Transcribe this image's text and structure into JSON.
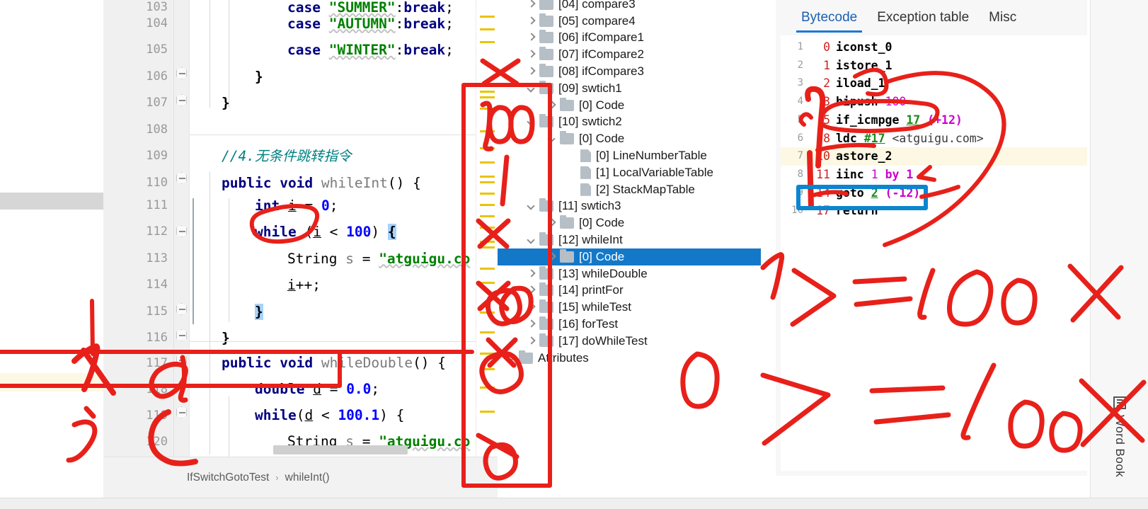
{
  "editor": {
    "breadcrumb": {
      "class_name": "IfSwitchGotoTest",
      "separator": "›",
      "method_name": "whileInt()"
    },
    "lines": [
      {
        "num": "103",
        "indent": 0
      },
      {
        "num": "104",
        "indent": 0
      },
      {
        "num": "105",
        "indent": 0
      },
      {
        "num": "106",
        "indent": 0
      },
      {
        "num": "107",
        "indent": 0
      },
      {
        "num": "108",
        "indent": 0
      },
      {
        "num": "109",
        "indent": 0
      },
      {
        "num": "110",
        "indent": 0
      },
      {
        "num": "111",
        "indent": 0
      },
      {
        "num": "112",
        "indent": 0
      },
      {
        "num": "113",
        "indent": 0
      },
      {
        "num": "114",
        "indent": 0
      },
      {
        "num": "115",
        "indent": 0
      },
      {
        "num": "116",
        "indent": 0
      },
      {
        "num": "117",
        "indent": 0
      },
      {
        "num": "118",
        "indent": 0
      },
      {
        "num": "119",
        "indent": 0
      },
      {
        "num": "120",
        "indent": 0
      }
    ],
    "code": {
      "l103": "case \"SUMMER\":break;",
      "l104": "case \"AUTUMN\":break;",
      "l105": "case \"WINTER\":break;",
      "l106": "}",
      "l107": "}",
      "l108": "",
      "l109": "//4.无条件跳转指令",
      "l110": "public void whileInt() {",
      "l111": "int i = 0;",
      "l112": "while (i < 100) {",
      "l113": "String s = \"atguigu.co",
      "l114": "i++;",
      "l115": "}",
      "l116": "}",
      "l117": "public void whileDouble() {",
      "l118": "double d = 0.0;",
      "l119": "while(d < 100.1) {",
      "l120": "String s = \"atguigu.co"
    },
    "tokens": {
      "kw_case": "case",
      "kw_break": "break",
      "kw_public": "public",
      "kw_void": "void",
      "kw_int": "int",
      "kw_double": "double",
      "kw_while": "while",
      "kw_String": "String",
      "str_summer": "\"SUMMER\"",
      "str_autumn": "\"AUTUMN\"",
      "str_winter": "\"WINTER\"",
      "str_atguigu": "\"atguigu.co",
      "num_0": "0",
      "num_100": "100",
      "num_0_0": "0.0",
      "num_100_1": "100.1",
      "m_whileInt": "whileInt",
      "m_whileDouble": "whileDouble",
      "v_i": "i",
      "v_d": "d",
      "v_s": "s",
      "comment109": "//4.无条件跳转指令"
    }
  },
  "tree": {
    "items": [
      {
        "label": "[04] compare3",
        "depth": 1,
        "twist": "right",
        "icon": "folder",
        "state": "normal"
      },
      {
        "label": "[05] compare4",
        "depth": 1,
        "twist": "right",
        "icon": "folder",
        "state": "normal"
      },
      {
        "label": "[06] ifCompare1",
        "depth": 1,
        "twist": "right",
        "icon": "folder",
        "state": "normal"
      },
      {
        "label": "[07] ifCompare2",
        "depth": 1,
        "twist": "right",
        "icon": "folder",
        "state": "normal"
      },
      {
        "label": "[08] ifCompare3",
        "depth": 1,
        "twist": "right",
        "icon": "folder",
        "state": "normal"
      },
      {
        "label": "[09] swtich1",
        "depth": 1,
        "twist": "down",
        "icon": "folder",
        "state": "normal"
      },
      {
        "label": "[0] Code",
        "depth": 2,
        "twist": "right",
        "icon": "folder",
        "state": "normal"
      },
      {
        "label": "[10] swtich2",
        "depth": 1,
        "twist": "down",
        "icon": "folder",
        "state": "normal"
      },
      {
        "label": "[0] Code",
        "depth": 2,
        "twist": "down",
        "icon": "folder",
        "state": "normal"
      },
      {
        "label": "[0] LineNumberTable",
        "depth": 3,
        "twist": "none",
        "icon": "attr",
        "state": "normal"
      },
      {
        "label": "[1] LocalVariableTable",
        "depth": 3,
        "twist": "none",
        "icon": "attr",
        "state": "normal"
      },
      {
        "label": "[2] StackMapTable",
        "depth": 3,
        "twist": "none",
        "icon": "attr",
        "state": "normal"
      },
      {
        "label": "[11] swtich3",
        "depth": 1,
        "twist": "down",
        "icon": "folder",
        "state": "normal"
      },
      {
        "label": "[0] Code",
        "depth": 2,
        "twist": "right",
        "icon": "folder",
        "state": "normal"
      },
      {
        "label": "[12] whileInt",
        "depth": 1,
        "twist": "down",
        "icon": "folder",
        "state": "normal"
      },
      {
        "label": "[0] Code",
        "depth": 2,
        "twist": "right",
        "icon": "folder",
        "state": "selected"
      },
      {
        "label": "[13] whileDouble",
        "depth": 1,
        "twist": "right",
        "icon": "folder",
        "state": "normal"
      },
      {
        "label": "[14] printFor",
        "depth": 1,
        "twist": "right",
        "icon": "folder",
        "state": "normal"
      },
      {
        "label": "[15] whileTest",
        "depth": 1,
        "twist": "right",
        "icon": "folder",
        "state": "normal"
      },
      {
        "label": "[16] forTest",
        "depth": 1,
        "twist": "right",
        "icon": "folder",
        "state": "normal"
      },
      {
        "label": "[17] doWhileTest",
        "depth": 1,
        "twist": "right",
        "icon": "folder",
        "state": "normal"
      },
      {
        "label": "Attributes",
        "depth": 0,
        "twist": "right",
        "icon": "folder",
        "state": "normal"
      }
    ]
  },
  "bytecode": {
    "tabs": [
      {
        "label": "Bytecode",
        "active": true
      },
      {
        "label": "Exception table",
        "active": false
      },
      {
        "label": "Misc",
        "active": false
      }
    ],
    "instructions": [
      {
        "no": "1",
        "offset": "0",
        "op": "iconst_0",
        "arg": "",
        "extra": "",
        "highlight": false
      },
      {
        "no": "2",
        "offset": "1",
        "op": "istore_1",
        "arg": "",
        "extra": "",
        "highlight": false
      },
      {
        "no": "3",
        "offset": "2",
        "op": "iload_1",
        "arg": "",
        "extra": "",
        "highlight": false
      },
      {
        "no": "4",
        "offset": "3",
        "op": "bipush",
        "arg": "100",
        "extra": "",
        "highlight": false
      },
      {
        "no": "5",
        "offset": "5",
        "op": "if_icmpge",
        "arg": "17",
        "extra": "(+12)",
        "highlight": false
      },
      {
        "no": "6",
        "offset": "8",
        "op": "ldc",
        "arg": "#17",
        "extra": "<atguigu.com>",
        "highlight": false
      },
      {
        "no": "7",
        "offset": "10",
        "op": "astore_2",
        "arg": "",
        "extra": "",
        "highlight": true
      },
      {
        "no": "8",
        "offset": "11",
        "op": "iinc",
        "arg": "1",
        "extra": "by 1",
        "highlight": false
      },
      {
        "no": "9",
        "offset": "14",
        "op": "goto",
        "arg": "2",
        "extra": "(-12)",
        "highlight": false
      },
      {
        "no": "10",
        "offset": "17",
        "op": "return",
        "arg": "",
        "extra": "",
        "highlight": false
      }
    ]
  },
  "sidebar_right": {
    "label": "Word Book",
    "icon": "book-icon"
  },
  "annotations": {
    "note_line1": "1 >= 100 ✗",
    "note_line2": "0 >= 100 ✗",
    "note_left_i": "i",
    "note_left_d": "d",
    "note_left_s": "s",
    "note_tree_100": "100",
    "ink_color": "#e8201a",
    "box_color": "#e8201a",
    "goto_box_color": "#0a86d0"
  },
  "colors": {
    "selection_blue": "#1478c8",
    "caret_row": "#fdf8e3",
    "keyword": "#000080",
    "string": "#008000",
    "number": "#0000ff",
    "comment": "#008080",
    "marker_yellow": "#e9c400",
    "tab_accent": "#1a7ad4"
  }
}
